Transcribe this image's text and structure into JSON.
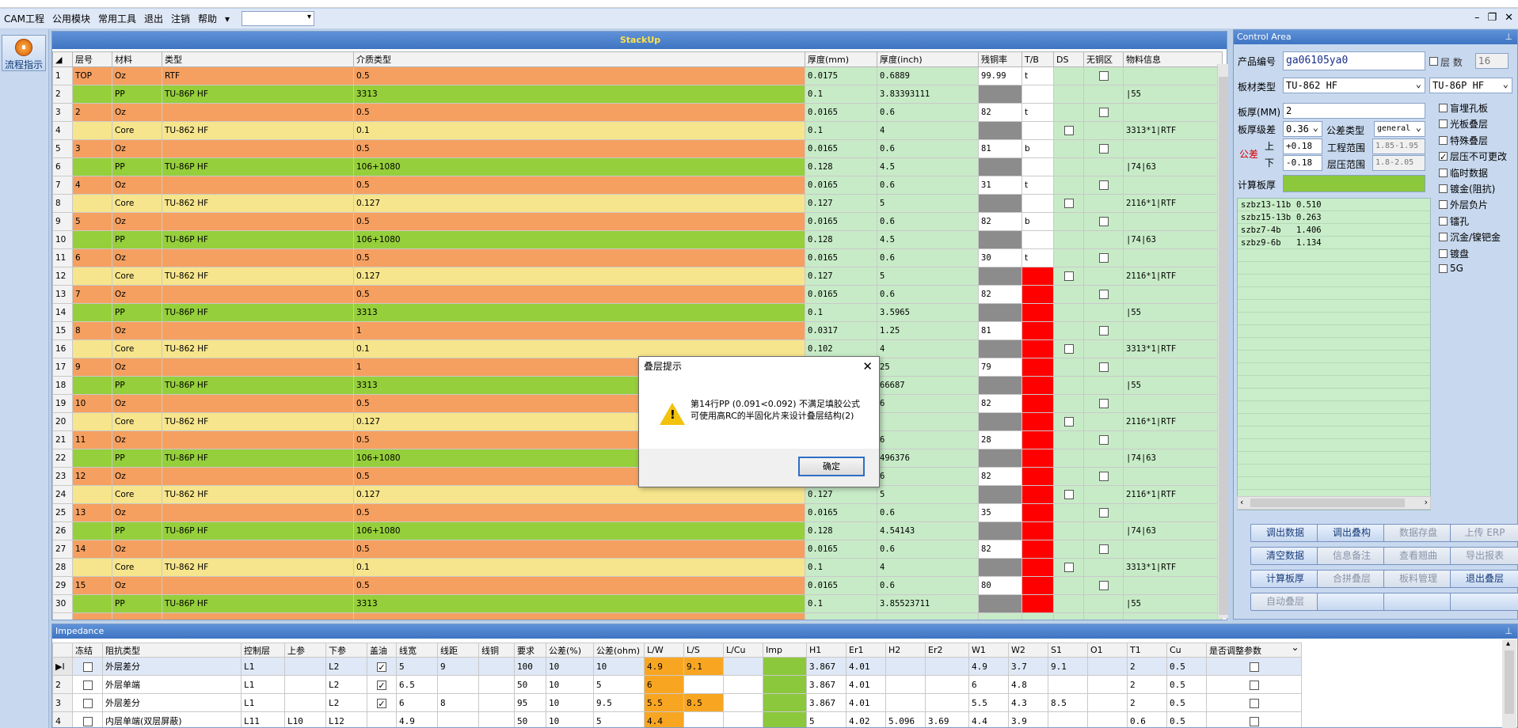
{
  "menu": {
    "items": [
      "CAM工程",
      "公用模块",
      "常用工具",
      "退出",
      "注销",
      "帮助"
    ]
  },
  "left": {
    "flow_button": "流程指示"
  },
  "stack": {
    "title": "StackUp",
    "columns": [
      "层号",
      "材料",
      "类型",
      "介质类型",
      "厚度(mm)",
      "厚度(inch)",
      "残铜率",
      "T/B",
      "DS",
      "无铜区",
      "物料信息"
    ],
    "rows": [
      {
        "n": "1",
        "layer": "TOP",
        "mat": "Oz",
        "type": "RTF",
        "diel": "0.5",
        "mm": "0.0175",
        "inch": "0.6889",
        "res": "99.99",
        "tb": "t",
        "kind": "cu",
        "rescls": "w",
        "tbcls": "w",
        "chk": true,
        "info": ""
      },
      {
        "n": "2",
        "layer": "",
        "mat": "PP",
        "type": "TU-86P HF",
        "diel": "3313",
        "mm": "0.1",
        "inch": "3.83393111",
        "res": "",
        "tb": "",
        "kind": "pp",
        "rescls": "gr",
        "tbcls": "w",
        "chk": false,
        "info": "|55"
      },
      {
        "n": "3",
        "layer": "2",
        "mat": "Oz",
        "type": "",
        "diel": "0.5",
        "mm": "0.0165",
        "inch": "0.6",
        "res": "82",
        "tb": "t",
        "kind": "cu",
        "rescls": "w",
        "tbcls": "w",
        "chk": true,
        "info": ""
      },
      {
        "n": "4",
        "layer": "",
        "mat": "Core",
        "type": "TU-862 HF",
        "diel": "0.1",
        "mm": "0.1",
        "inch": "4",
        "res": "",
        "tb": "",
        "kind": "core",
        "rescls": "gr",
        "tbcls": "w",
        "ds": true,
        "chk": false,
        "info": "3313*1|RTF"
      },
      {
        "n": "5",
        "layer": "3",
        "mat": "Oz",
        "type": "",
        "diel": "0.5",
        "mm": "0.0165",
        "inch": "0.6",
        "res": "81",
        "tb": "b",
        "kind": "cu",
        "rescls": "w",
        "tbcls": "w",
        "chk": true,
        "info": ""
      },
      {
        "n": "6",
        "layer": "",
        "mat": "PP",
        "type": "TU-86P HF",
        "diel": "106+1080",
        "mm": "0.128",
        "inch": "4.5",
        "res": "",
        "tb": "",
        "kind": "pp",
        "rescls": "gr",
        "tbcls": "w",
        "chk": false,
        "info": "|74|63"
      },
      {
        "n": "7",
        "layer": "4",
        "mat": "Oz",
        "type": "",
        "diel": "0.5",
        "mm": "0.0165",
        "inch": "0.6",
        "res": "31",
        "tb": "t",
        "kind": "cu",
        "rescls": "w",
        "tbcls": "w",
        "chk": true,
        "info": ""
      },
      {
        "n": "8",
        "layer": "",
        "mat": "Core",
        "type": "TU-862 HF",
        "diel": "0.127",
        "mm": "0.127",
        "inch": "5",
        "res": "",
        "tb": "",
        "kind": "core",
        "rescls": "gr",
        "tbcls": "w",
        "ds": true,
        "chk": false,
        "info": "2116*1|RTF"
      },
      {
        "n": "9",
        "layer": "5",
        "mat": "Oz",
        "type": "",
        "diel": "0.5",
        "mm": "0.0165",
        "inch": "0.6",
        "res": "82",
        "tb": "b",
        "kind": "cu",
        "rescls": "w",
        "tbcls": "w",
        "chk": true,
        "info": ""
      },
      {
        "n": "10",
        "layer": "",
        "mat": "PP",
        "type": "TU-86P HF",
        "diel": "106+1080",
        "mm": "0.128",
        "inch": "4.5",
        "res": "",
        "tb": "",
        "kind": "pp",
        "rescls": "gr",
        "tbcls": "w",
        "chk": false,
        "info": "|74|63"
      },
      {
        "n": "11",
        "layer": "6",
        "mat": "Oz",
        "type": "",
        "diel": "0.5",
        "mm": "0.0165",
        "inch": "0.6",
        "res": "30",
        "tb": "t",
        "kind": "cu",
        "rescls": "w",
        "tbcls": "w",
        "chk": true,
        "info": ""
      },
      {
        "n": "12",
        "layer": "",
        "mat": "Core",
        "type": "TU-862 HF",
        "diel": "0.127",
        "mm": "0.127",
        "inch": "5",
        "res": "",
        "tb": "",
        "kind": "core",
        "rescls": "gr",
        "tbcls": "rd",
        "ds": true,
        "chk": false,
        "info": "2116*1|RTF"
      },
      {
        "n": "13",
        "layer": "7",
        "mat": "Oz",
        "type": "",
        "diel": "0.5",
        "mm": "0.0165",
        "inch": "0.6",
        "res": "82",
        "tb": "b",
        "kind": "cu",
        "rescls": "w",
        "tbcls": "rd",
        "chk": true,
        "info": ""
      },
      {
        "n": "14",
        "layer": "",
        "mat": "PP",
        "type": "TU-86P HF",
        "diel": "3313",
        "mm": "0.1",
        "inch": "3.5965",
        "res": "",
        "tb": "",
        "kind": "pp",
        "rescls": "gr",
        "tbcls": "rd",
        "chk": false,
        "info": "|55"
      },
      {
        "n": "15",
        "layer": "8",
        "mat": "Oz",
        "type": "",
        "diel": "1",
        "mm": "0.0317",
        "inch": "1.25",
        "res": "81",
        "tb": "t",
        "kind": "cu",
        "rescls": "w",
        "tbcls": "rd",
        "chk": true,
        "info": ""
      },
      {
        "n": "16",
        "layer": "",
        "mat": "Core",
        "type": "TU-862 HF",
        "diel": "0.1",
        "mm": "0.102",
        "inch": "4",
        "res": "",
        "tb": "",
        "kind": "core",
        "rescls": "gr",
        "tbcls": "rd",
        "ds": true,
        "chk": false,
        "info": "3313*1|RTF"
      },
      {
        "n": "17",
        "layer": "9",
        "mat": "Oz",
        "type": "",
        "diel": "1",
        "mm": "",
        "inch": "25",
        "res": "79",
        "tb": "b",
        "kind": "cu",
        "rescls": "w",
        "tbcls": "rd",
        "chk": true,
        "info": ""
      },
      {
        "n": "18",
        "layer": "",
        "mat": "PP",
        "type": "TU-86P HF",
        "diel": "3313",
        "mm": "",
        "inch": "66687",
        "res": "",
        "tb": "",
        "kind": "pp",
        "rescls": "gr",
        "tbcls": "rd",
        "chk": false,
        "info": "|55"
      },
      {
        "n": "19",
        "layer": "10",
        "mat": "Oz",
        "type": "",
        "diel": "0.5",
        "mm": "",
        "inch": "6",
        "res": "82",
        "tb": "t",
        "kind": "cu",
        "rescls": "w",
        "tbcls": "rd",
        "chk": true,
        "info": ""
      },
      {
        "n": "20",
        "layer": "",
        "mat": "Core",
        "type": "TU-862 HF",
        "diel": "0.127",
        "mm": "",
        "inch": "",
        "res": "",
        "tb": "",
        "kind": "core",
        "rescls": "gr",
        "tbcls": "rd",
        "ds": true,
        "chk": false,
        "info": "2116*1|RTF"
      },
      {
        "n": "21",
        "layer": "11",
        "mat": "Oz",
        "type": "",
        "diel": "0.5",
        "mm": "",
        "inch": "6",
        "res": "28",
        "tb": "b",
        "kind": "cu",
        "rescls": "w",
        "tbcls": "rd",
        "chk": true,
        "info": ""
      },
      {
        "n": "22",
        "layer": "",
        "mat": "PP",
        "type": "TU-86P HF",
        "diel": "106+1080",
        "mm": "",
        "inch": "496376",
        "res": "",
        "tb": "",
        "kind": "pp",
        "rescls": "gr",
        "tbcls": "rd",
        "chk": false,
        "info": "|74|63"
      },
      {
        "n": "23",
        "layer": "12",
        "mat": "Oz",
        "type": "",
        "diel": "0.5",
        "mm": "",
        "inch": "6",
        "res": "82",
        "tb": "t",
        "kind": "cu",
        "rescls": "w",
        "tbcls": "rd",
        "chk": true,
        "info": ""
      },
      {
        "n": "24",
        "layer": "",
        "mat": "Core",
        "type": "TU-862 HF",
        "diel": "0.127",
        "mm": "0.127",
        "inch": "5",
        "res": "",
        "tb": "",
        "kind": "core",
        "rescls": "gr",
        "tbcls": "rd",
        "ds": true,
        "chk": false,
        "info": "2116*1|RTF"
      },
      {
        "n": "25",
        "layer": "13",
        "mat": "Oz",
        "type": "",
        "diel": "0.5",
        "mm": "0.0165",
        "inch": "0.6",
        "res": "35",
        "tb": "b",
        "kind": "cu",
        "rescls": "w",
        "tbcls": "rd",
        "chk": true,
        "info": ""
      },
      {
        "n": "26",
        "layer": "",
        "mat": "PP",
        "type": "TU-86P HF",
        "diel": "106+1080",
        "mm": "0.128",
        "inch": "4.54143",
        "res": "",
        "tb": "",
        "kind": "pp",
        "rescls": "gr",
        "tbcls": "rd",
        "chk": false,
        "info": "|74|63"
      },
      {
        "n": "27",
        "layer": "14",
        "mat": "Oz",
        "type": "",
        "diel": "0.5",
        "mm": "0.0165",
        "inch": "0.6",
        "res": "82",
        "tb": "t",
        "kind": "cu",
        "rescls": "w",
        "tbcls": "rd",
        "chk": true,
        "info": ""
      },
      {
        "n": "28",
        "layer": "",
        "mat": "Core",
        "type": "TU-862 HF",
        "diel": "0.1",
        "mm": "0.1",
        "inch": "4",
        "res": "",
        "tb": "",
        "kind": "core",
        "rescls": "gr",
        "tbcls": "rd",
        "ds": true,
        "chk": false,
        "info": "3313*1|RTF"
      },
      {
        "n": "29",
        "layer": "15",
        "mat": "Oz",
        "type": "",
        "diel": "0.5",
        "mm": "0.0165",
        "inch": "0.6",
        "res": "80",
        "tb": "b",
        "kind": "cu",
        "rescls": "w",
        "tbcls": "rd",
        "chk": true,
        "info": ""
      },
      {
        "n": "30",
        "layer": "",
        "mat": "PP",
        "type": "TU-86P HF",
        "diel": "3313",
        "mm": "0.1",
        "inch": "3.85523711",
        "res": "",
        "tb": "",
        "kind": "pp",
        "rescls": "gr",
        "tbcls": "rd",
        "chk": false,
        "info": "|55"
      }
    ]
  },
  "control": {
    "title": "Control Area",
    "product_label": "产品编号",
    "product_value": "ga06105ya0",
    "layers_label": "层 数",
    "layers_value": "16",
    "board_type_label": "板材类型",
    "board_type_value": "TU-862 HF",
    "board_type_value2": "TU-86P HF",
    "thickness_label": "板厚(MM)",
    "thickness_value": "2",
    "tol_level_label": "板厚级差",
    "tol_level_value": "0.36",
    "tol_type_label": "公差类型",
    "tol_type_value": "general",
    "tol_label": "公差",
    "upper_label": "上",
    "upper_value": "+0.18",
    "lower_label": "下",
    "lower_value": "-0.18",
    "eng_range_label": "工程范围",
    "eng_range_value": "1.85-1.95",
    "press_range_label": "层压范围",
    "press_range_value": "1.8-2.05",
    "calc_label": "计算板厚",
    "side_options": [
      {
        "label": "盲埋孔板",
        "checked": false
      },
      {
        "label": "光板叠层",
        "checked": false
      },
      {
        "label": "特殊叠层",
        "checked": false
      },
      {
        "label": "层压不可更改",
        "checked": true
      },
      {
        "label": "临时数据",
        "checked": false
      },
      {
        "label": "镀金(阻抗)",
        "checked": false
      },
      {
        "label": "外层负片",
        "checked": false
      },
      {
        "label": "镭孔",
        "checked": false
      },
      {
        "label": "沉金/镍钯金",
        "checked": false
      },
      {
        "label": "镀盘",
        "checked": false
      },
      {
        "label": "5G",
        "checked": false
      }
    ],
    "drills": [
      {
        "name": "szbz13-11b",
        "val": "0.510"
      },
      {
        "name": "szbz15-13b",
        "val": "0.263"
      },
      {
        "name": "szbz7-4b",
        "val": "1.406"
      },
      {
        "name": "szbz9-6b",
        "val": "1.134"
      }
    ],
    "buttons": [
      {
        "label": "调出数据",
        "disabled": false
      },
      {
        "label": "调出叠构",
        "disabled": false
      },
      {
        "label": "数据存盘",
        "disabled": true
      },
      {
        "label": "上传 ERP",
        "disabled": true
      },
      {
        "label": "清空数据",
        "disabled": false
      },
      {
        "label": "信息备注",
        "disabled": true
      },
      {
        "label": "查看翘曲",
        "disabled": true
      },
      {
        "label": "导出报表",
        "disabled": true
      },
      {
        "label": "计算板厚",
        "disabled": false
      },
      {
        "label": "合拼叠层",
        "disabled": true
      },
      {
        "label": "板料管理",
        "disabled": true
      },
      {
        "label": "退出叠层",
        "disabled": false
      },
      {
        "label": "自动叠层",
        "disabled": true
      },
      {
        "label": "",
        "disabled": false
      },
      {
        "label": "",
        "disabled": false
      },
      {
        "label": "",
        "disabled": false
      }
    ]
  },
  "impedance": {
    "title": "Impedance",
    "columns": [
      "冻结",
      "阻抗类型",
      "控制层",
      "上参",
      "下参",
      "盖油",
      "线宽",
      "线距",
      "线铜",
      "要求",
      "公差(%)",
      "公差(ohm)",
      "L/W",
      "L/S",
      "L/Cu",
      "Imp",
      "H1",
      "Er1",
      "H2",
      "Er2",
      "W1",
      "W2",
      "S1",
      "O1",
      "T1",
      "Cu",
      "是否调整参数"
    ],
    "rows": [
      {
        "n": "1",
        "type": "外层差分",
        "ctrl": "L1",
        "up": "",
        "down": "L2",
        "oil": true,
        "w": "5",
        "s": "9",
        "cu": "",
        "req": "100",
        "tolp": "10",
        "tolo": "10",
        "lw": "4.9",
        "ls": "9.1",
        "lcu": "",
        "h1": "3.867",
        "er1": "4.01",
        "h2": "",
        "er2": "",
        "w1": "4.9",
        "w2": "3.7",
        "s1": "9.1",
        "o1": "",
        "t1": "2",
        "cuv": "0.5",
        "selected": true
      },
      {
        "n": "2",
        "type": "外层单端",
        "ctrl": "L1",
        "up": "",
        "down": "L2",
        "oil": true,
        "w": "6.5",
        "s": "",
        "cu": "",
        "req": "50",
        "tolp": "10",
        "tolo": "5",
        "lw": "6",
        "ls": "",
        "lcu": "",
        "h1": "3.867",
        "er1": "4.01",
        "h2": "",
        "er2": "",
        "w1": "6",
        "w2": "4.8",
        "s1": "",
        "o1": "",
        "t1": "2",
        "cuv": "0.5",
        "selected": false
      },
      {
        "n": "3",
        "type": "外层差分",
        "ctrl": "L1",
        "up": "",
        "down": "L2",
        "oil": true,
        "w": "6",
        "s": "8",
        "cu": "",
        "req": "95",
        "tolp": "10",
        "tolo": "9.5",
        "lw": "5.5",
        "ls": "8.5",
        "lcu": "",
        "h1": "3.867",
        "er1": "4.01",
        "h2": "",
        "er2": "",
        "w1": "5.5",
        "w2": "4.3",
        "s1": "8.5",
        "o1": "",
        "t1": "2",
        "cuv": "0.5",
        "selected": false
      },
      {
        "n": "4",
        "type": "内层单端(双层屏蔽)",
        "ctrl": "L11",
        "up": "L10",
        "down": "L12",
        "oil": false,
        "w": "4.9",
        "s": "",
        "cu": "",
        "req": "50",
        "tolp": "10",
        "tolo": "5",
        "lw": "4.4",
        "ls": "",
        "lcu": "",
        "h1": "5",
        "er1": "4.02",
        "h2": "5.096",
        "er2": "3.69",
        "w1": "4.4",
        "w2": "3.9",
        "s1": "",
        "o1": "",
        "t1": "0.6",
        "cuv": "0.5",
        "selected": false
      }
    ]
  },
  "dialog": {
    "title": "叠层提示",
    "line1": "第14行PP (0.091<0.092) 不满足填胶公式",
    "line2": "可使用高RC的半固化片来设计叠层结构(2)",
    "ok": "确定"
  }
}
